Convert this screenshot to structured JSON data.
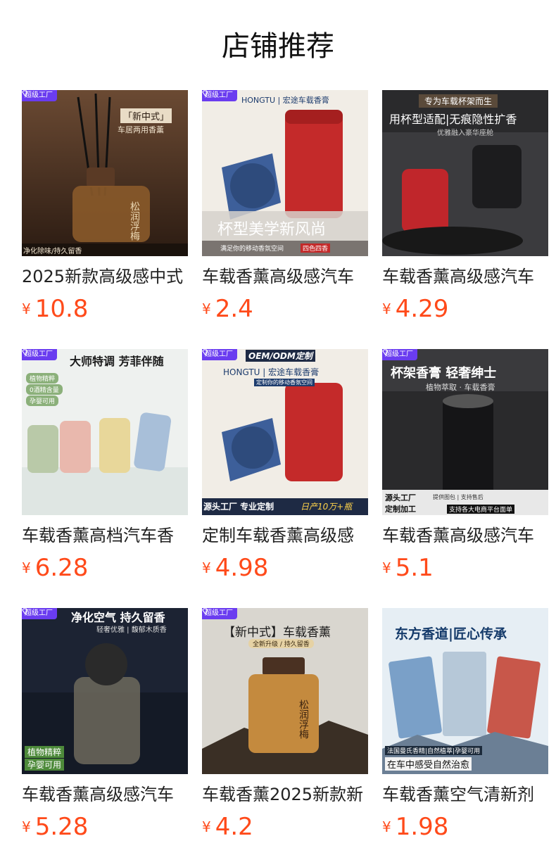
{
  "header": {
    "title": "店铺推荐"
  },
  "colors": {
    "price": "#ff4a1a",
    "badge": "#6a3cf0"
  },
  "currency": "¥",
  "badge_label": "超级工厂",
  "products": [
    {
      "name": "2025新款高级感中式",
      "price": "10.8",
      "badge": true,
      "image": {
        "icon": "reed-diffuser-image",
        "texts": [
          "「新中式」",
          "车居两用香薰",
          "松润浮梅",
          "净化除味/持久留香"
        ]
      }
    },
    {
      "name": "车载香薰高级感汽车",
      "price": "2.4",
      "badge": true,
      "image": {
        "icon": "cup-holder-fragrance-image",
        "texts": [
          "HONGTU | 宏途车载香膏",
          "杯型美学新风尚",
          "满足你的移动香氛空间",
          "四色四香"
        ]
      }
    },
    {
      "name": "车载香薰高级感汽车",
      "price": "4.29",
      "badge": false,
      "image": {
        "icon": "cup-holder-fragrance-image",
        "texts": [
          "专为车载杯架而生",
          "用杯型适配|无痕隐性扩香",
          "优雅融入豪华座舱"
        ]
      }
    },
    {
      "name": "车载香薰高档汽车香",
      "price": "6.28",
      "badge": true,
      "image": {
        "icon": "perfume-bottles-image",
        "texts": [
          "大师特调 芳菲伴随",
          "植物精粹",
          "0酒精含量",
          "孕婴可用"
        ]
      }
    },
    {
      "name": "定制车载香薰高级感",
      "price": "4.98",
      "badge": true,
      "image": {
        "icon": "cup-holder-fragrance-image",
        "texts": [
          "OEM/ODM定制",
          "HONGTU | 宏途车载香膏",
          "定制你的移动香氛空间",
          "源头工厂 专业定制",
          "日产10万+瓶"
        ]
      }
    },
    {
      "name": "车载香薰高级感汽车",
      "price": "5.1",
      "badge": true,
      "image": {
        "icon": "car-perfume-can-image",
        "texts": [
          "杯架香膏 轻奢绅士",
          "植物萃取 · 车载香膏",
          "源头工厂",
          "定制加工",
          "提供图包 | 支持售后",
          "支持各大电商平台面单"
        ]
      }
    },
    {
      "name": "车载香薰高级感汽车",
      "price": "5.28",
      "badge": true,
      "image": {
        "icon": "car-perfume-bottle-image",
        "texts": [
          "净化空气 持久留香",
          "轻奢优雅 | 馥郁木质香",
          "植物精粹",
          "孕婴可用"
        ]
      }
    },
    {
      "name": "车载香薰2025新款新",
      "price": "4.2",
      "badge": true,
      "image": {
        "icon": "amber-perfume-bottle-image",
        "texts": [
          "【新中式】车载香薰",
          "全新升级 / 持久留香",
          "松润浮梅"
        ]
      }
    },
    {
      "name": "车载香薰空气清新剂",
      "price": "1.98",
      "badge": false,
      "image": {
        "icon": "fragrance-cards-image",
        "texts": [
          "东方香道|匠心传承",
          "法国曼氏香精|自然植萃|孕婴可用",
          "在车中感受自然治愈"
        ]
      }
    }
  ]
}
